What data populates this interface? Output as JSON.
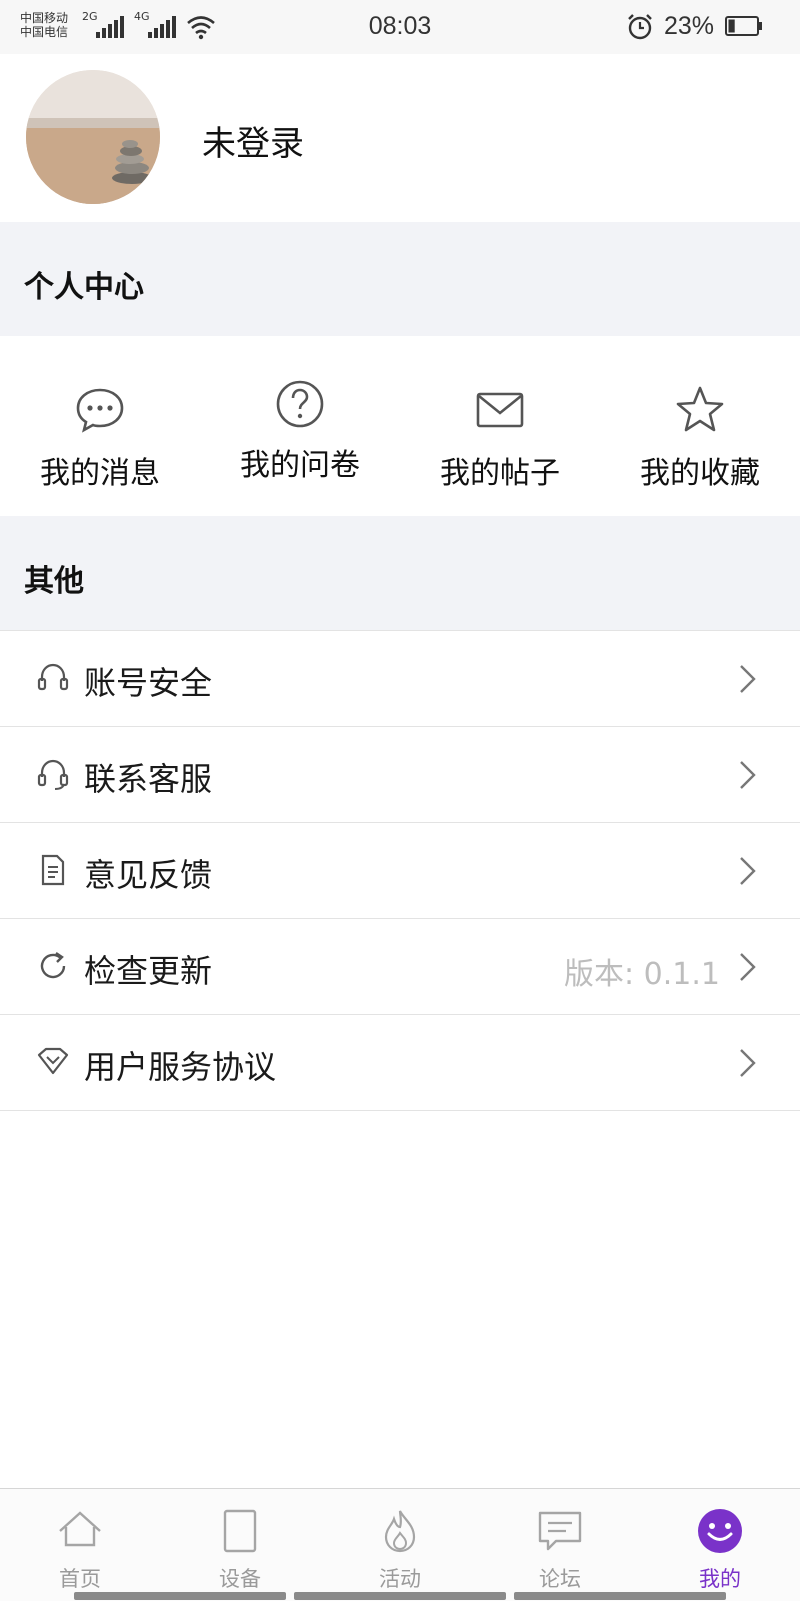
{
  "status_bar": {
    "carrier_1": "中国移动",
    "carrier_2": "中国电信",
    "net_1": "2G",
    "net_2": "4G",
    "time": "08:03",
    "battery_percent": "23%",
    "battery_level": 0.23
  },
  "profile": {
    "username": "未登录"
  },
  "personal_center": {
    "title": "个人中心",
    "actions": [
      {
        "label": "我的消息",
        "icon": "chat-bubble-icon"
      },
      {
        "label": "我的问卷",
        "icon": "question-circle-icon"
      },
      {
        "label": "我的帖子",
        "icon": "envelope-icon"
      },
      {
        "label": "我的收藏",
        "icon": "star-icon"
      }
    ]
  },
  "other": {
    "title": "其他",
    "items": [
      {
        "label": "账号安全",
        "icon": "headset-icon",
        "value": ""
      },
      {
        "label": "联系客服",
        "icon": "headset-icon",
        "value": ""
      },
      {
        "label": "意见反馈",
        "icon": "document-icon",
        "value": ""
      },
      {
        "label": "检查更新",
        "icon": "refresh-icon",
        "value": "版本: 0.1.1"
      },
      {
        "label": "用户服务协议",
        "icon": "shield-icon",
        "value": ""
      }
    ]
  },
  "tabbar": {
    "accent_color": "#7a32c9",
    "tabs": [
      {
        "label": "首页",
        "icon": "home-icon",
        "active": false
      },
      {
        "label": "设备",
        "icon": "device-icon",
        "active": false
      },
      {
        "label": "活动",
        "icon": "flame-icon",
        "active": false
      },
      {
        "label": "论坛",
        "icon": "forum-icon",
        "active": false
      },
      {
        "label": "我的",
        "icon": "smiley-icon",
        "active": true
      }
    ]
  }
}
